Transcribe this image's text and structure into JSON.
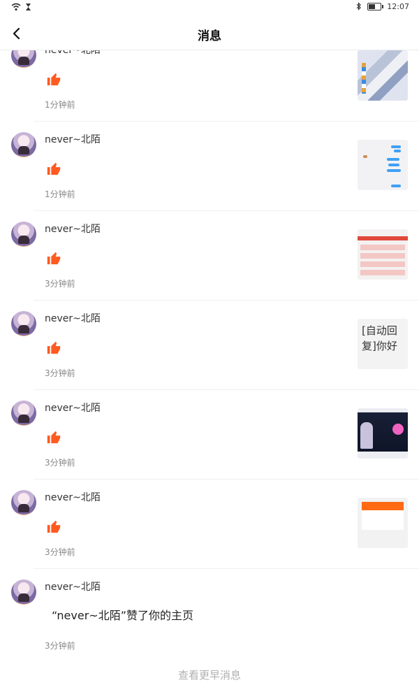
{
  "status_bar": {
    "time": "12:07",
    "battery_level": 0.55
  },
  "header": {
    "title": "消息"
  },
  "colors": {
    "like": "#ff5a1f",
    "chat_bubble": "#3ea1f5",
    "app_orange": "#ff6a13"
  },
  "items": [
    {
      "user": "never~北陌",
      "time": "1分钟前",
      "type": "like",
      "thumb": "collage"
    },
    {
      "user": "never~北陌",
      "time": "1分钟前",
      "type": "like",
      "thumb": "chat"
    },
    {
      "user": "never~北陌",
      "time": "3分钟前",
      "type": "like",
      "thumb": "list"
    },
    {
      "user": "never~北陌",
      "time": "3分钟前",
      "type": "like",
      "thumb": "text",
      "thumb_text": "[自动回复]你好"
    },
    {
      "user": "never~北陌",
      "time": "3分钟前",
      "type": "like",
      "thumb": "dark"
    },
    {
      "user": "never~北陌",
      "time": "3分钟前",
      "type": "like",
      "thumb": "app"
    },
    {
      "user": "never~北陌",
      "time": "3分钟前",
      "type": "message",
      "message": "“never~北陌”赞了你的主页"
    }
  ],
  "footer": {
    "more_label": "查看更早消息"
  },
  "icons": {
    "back": "chevron-left-icon",
    "like": "thumbs-up-icon",
    "wifi": "wifi-icon",
    "hourglass": "hourglass-icon",
    "bluetooth": "bluetooth-icon",
    "battery": "battery-icon"
  }
}
